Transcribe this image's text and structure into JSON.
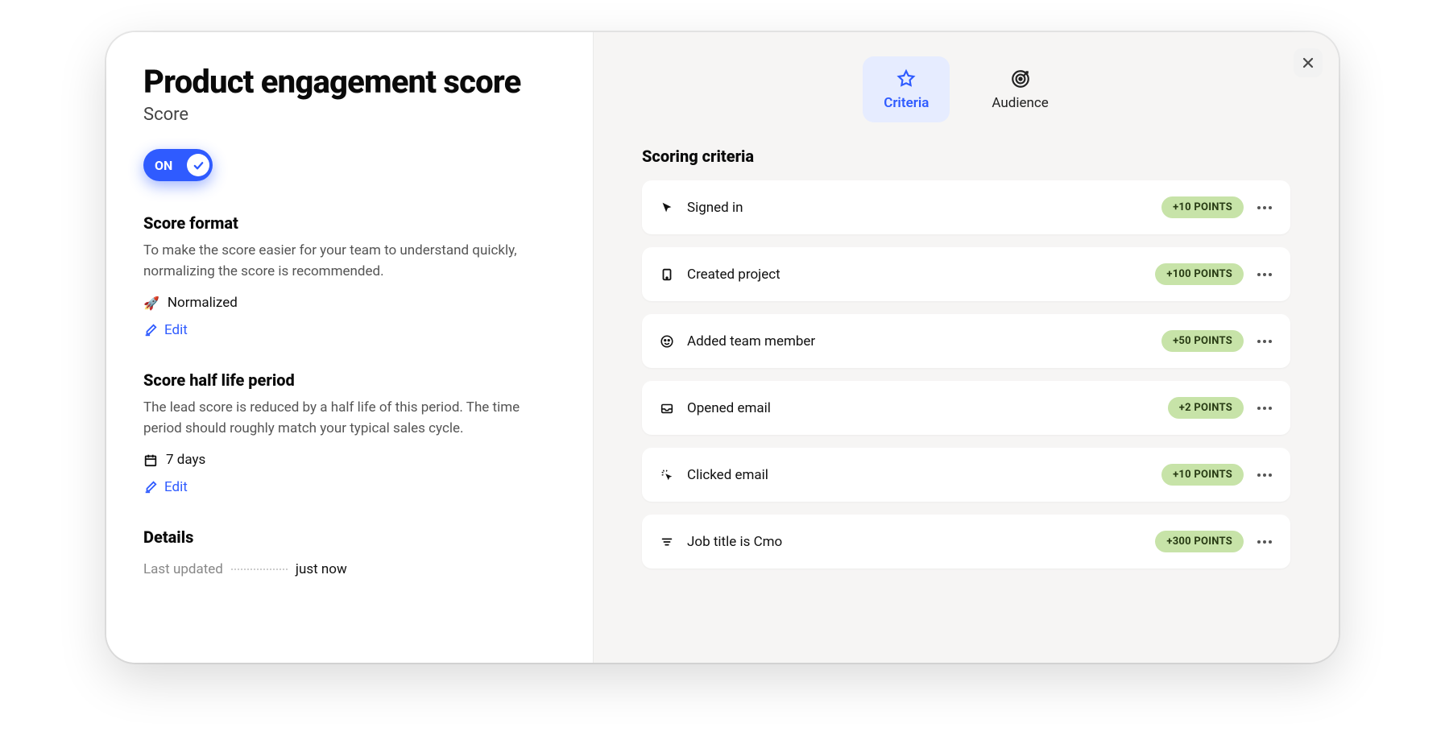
{
  "header": {
    "title": "Product engagement score",
    "subtitle": "Score"
  },
  "toggle": {
    "label": "ON",
    "state": true
  },
  "score_format": {
    "heading": "Score format",
    "description": "To make the score easier for your team to understand quickly, normalizing the score is recommended.",
    "value": "Normalized",
    "edit_label": "Edit"
  },
  "half_life": {
    "heading": "Score half life period",
    "description": "The lead score is reduced by a half life of this period. The time period should roughly match your typical sales cycle.",
    "value": "7 days",
    "edit_label": "Edit"
  },
  "details": {
    "heading": "Details",
    "last_updated_label": "Last updated",
    "last_updated_value": "just now"
  },
  "tabs": {
    "criteria": "Criteria",
    "audience": "Audience"
  },
  "criteria": {
    "heading": "Scoring criteria",
    "items": [
      {
        "label": "Signed in",
        "points": "+10 POINTS",
        "icon": "cursor"
      },
      {
        "label": "Created project",
        "points": "+100 POINTS",
        "icon": "tablet"
      },
      {
        "label": "Added team member",
        "points": "+50 POINTS",
        "icon": "smile"
      },
      {
        "label": "Opened email",
        "points": "+2 POINTS",
        "icon": "inbox"
      },
      {
        "label": "Clicked email",
        "points": "+10 POINTS",
        "icon": "cursor-click"
      },
      {
        "label": "Job title is Cmo",
        "points": "+300 POINTS",
        "icon": "filter"
      }
    ]
  }
}
